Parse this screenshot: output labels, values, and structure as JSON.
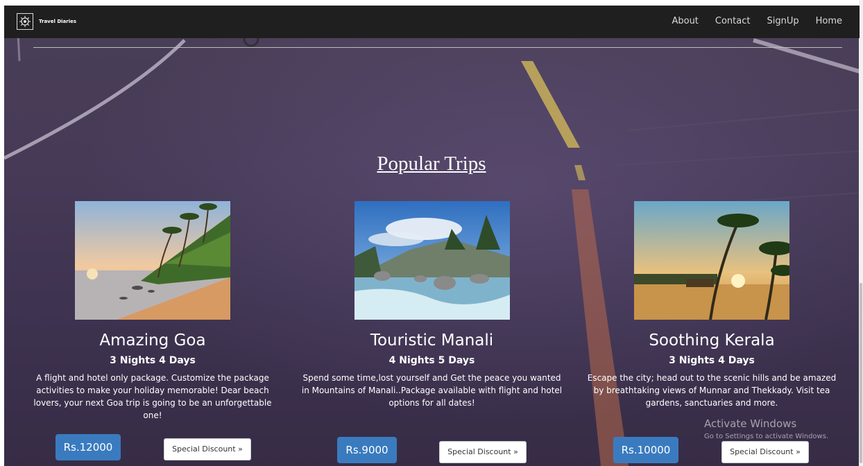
{
  "navbar": {
    "brand": "Travel Diaries",
    "links": [
      "About",
      "Contact",
      "SignUp",
      "Home"
    ]
  },
  "section": {
    "title": "Popular Trips"
  },
  "trips": [
    {
      "title": "Amazing Goa",
      "duration": "3 Nights 4 Days",
      "description": "A flight and hotel only package. Customize the package activities to make your holiday memorable! Dear beach lovers, your next Goa trip is going to be an unforgettable one!",
      "price": "Rs.12000",
      "discount_label": "Special Discount »"
    },
    {
      "title": "Touristic Manali",
      "duration": "4 Nights 5 Days",
      "description": "Spend some time,lost yourself and Get the peace you wanted in Mountains of Manali..Package available with flight and hotel options for all dates!",
      "price": "Rs.9000",
      "discount_label": "Special Discount »"
    },
    {
      "title": "Soothing Kerala",
      "duration": "3 Nights 4 Days",
      "description": "Escape the city; head out to the scenic hills and be amazed by breathtaking views of Munnar and Thekkady. Visit tea gardens, sanctuaries and more.",
      "price": "Rs.10000",
      "discount_label": "Special Discount »"
    }
  ],
  "watermark": {
    "line1": "Activate Windows",
    "line2": "Go to Settings to activate Windows."
  },
  "colors": {
    "navbar": "#1f1f1f",
    "price_button": "#3a7bbf",
    "background": "#463a57"
  }
}
